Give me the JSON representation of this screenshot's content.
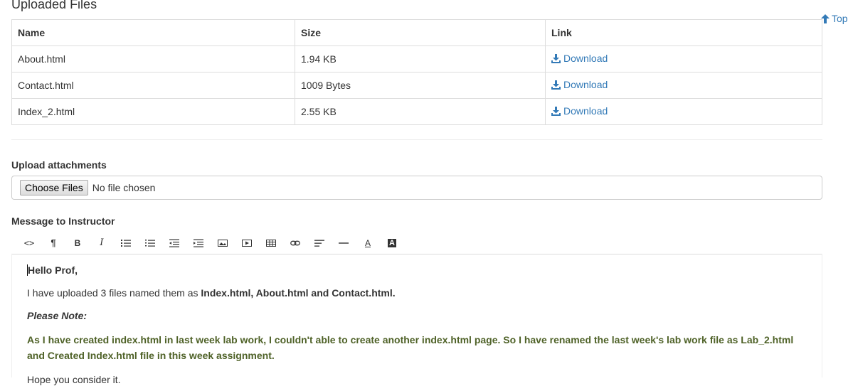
{
  "uploaded": {
    "title": "Uploaded Files",
    "top_link": "Top",
    "columns": [
      "Name",
      "Size",
      "Link"
    ],
    "rows": [
      {
        "name": "About.html",
        "size": "1.94 KB",
        "link": "Download"
      },
      {
        "name": "Contact.html",
        "size": "1009 Bytes",
        "link": "Download"
      },
      {
        "name": "Index_2.html",
        "size": "2.55 KB",
        "link": "Download"
      }
    ],
    "download_icon": "download-icon",
    "link_color": "#337ab7"
  },
  "upload": {
    "label": "Upload attachments",
    "choose_button": "Choose Files",
    "status": "No file chosen"
  },
  "message": {
    "label": "Message to Instructor",
    "toolbar": [
      {
        "name": "code-view-icon",
        "glyph": "<>"
      },
      {
        "name": "paragraph-icon",
        "glyph": "¶"
      },
      {
        "name": "bold-icon",
        "glyph": "B"
      },
      {
        "name": "italic-icon",
        "glyph": "I"
      },
      {
        "name": "unordered-list-icon",
        "glyph": ""
      },
      {
        "name": "ordered-list-icon",
        "glyph": ""
      },
      {
        "name": "outdent-icon",
        "glyph": ""
      },
      {
        "name": "indent-icon",
        "glyph": ""
      },
      {
        "name": "image-icon",
        "glyph": ""
      },
      {
        "name": "video-icon",
        "glyph": ""
      },
      {
        "name": "table-icon",
        "glyph": ""
      },
      {
        "name": "link-icon",
        "glyph": ""
      },
      {
        "name": "align-left-icon",
        "glyph": ""
      },
      {
        "name": "horizontal-rule-icon",
        "glyph": ""
      },
      {
        "name": "font-color-icon",
        "glyph": "A"
      },
      {
        "name": "background-color-icon",
        "glyph": "A"
      }
    ],
    "body": {
      "greeting": "Hello Prof,",
      "line1_text": "I have uploaded 3 files named them as ",
      "line1_bold": "Index.html, About.html and Contact.html.",
      "note_label": "Please Note:",
      "note_text": "As I have created index.html in last week lab work, I couldn't able to create another index.html page. So I have renamed the last week's lab work file as Lab_2.html and Created Index.html file in this week assignment.",
      "closing": "Hope you consider it."
    },
    "note_color": "#4f6228"
  }
}
